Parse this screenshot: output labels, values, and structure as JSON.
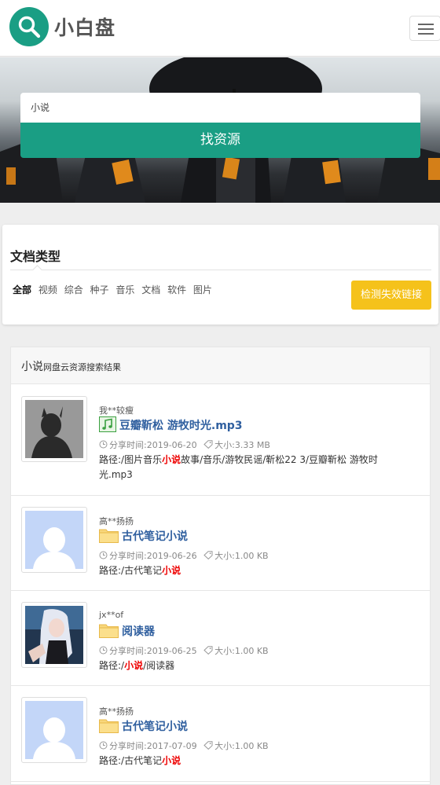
{
  "header": {
    "logo_text": "小白盘",
    "menu_icon": "hamburger-icon"
  },
  "search": {
    "value": "小说",
    "button_label": "找资源"
  },
  "filter": {
    "title": "文档类型",
    "tabs": [
      "全部",
      "视频",
      "综合",
      "种子",
      "音乐",
      "文档",
      "软件",
      "图片"
    ],
    "active_tab": "全部",
    "check_button": "检测失效链接"
  },
  "results": {
    "query": "小说",
    "heading_suffix": "网盘云资源搜索结果",
    "items": [
      {
        "user": "我**较瘦",
        "type": "music",
        "name": "豆瓣靳松 游牧时光.mp3",
        "date": "分享时间:2019-06-20",
        "size": "大小:3.33 MB",
        "path_parts": [
          "路径:/图片音乐",
          "小说",
          "故事/音乐/游牧民谣/靳松22 3/豆瓣靳松 游牧时光.mp3"
        ]
      },
      {
        "user": "高**扬扬",
        "type": "folder",
        "name": "古代笔记小说",
        "date": "分享时间:2019-06-26",
        "size": "大小:1.00 KB",
        "path_parts": [
          "路径:/古代笔记",
          "小说",
          ""
        ]
      },
      {
        "user": "jx**of",
        "type": "folder",
        "name": "阅读器",
        "date": "分享时间:2019-06-25",
        "size": "大小:1.00 KB",
        "path_parts": [
          "路径:/",
          "小说",
          "/阅读器"
        ]
      },
      {
        "user": "高**扬扬",
        "type": "folder",
        "name": "古代笔记小说",
        "date": "分享时间:2017-07-09",
        "size": "大小:1.00 KB",
        "path_parts": [
          "路径:/古代笔记",
          "小说",
          ""
        ]
      }
    ]
  },
  "colors": {
    "brand": "#1a9e84",
    "warning": "#f5c21b",
    "link": "#2f5f9f",
    "highlight": "#e00000"
  }
}
